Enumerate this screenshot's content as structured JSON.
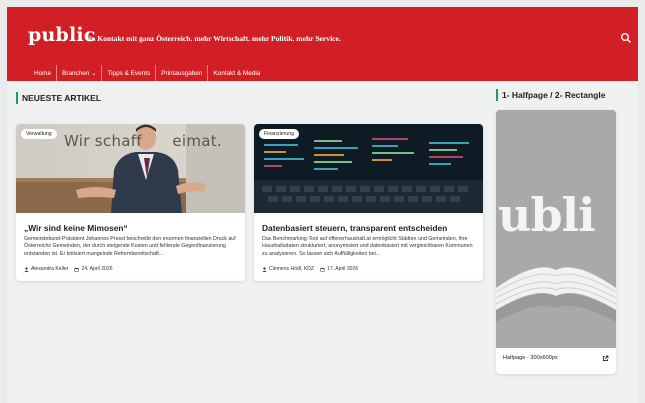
{
  "header": {
    "logo": "public",
    "tagline": "in Kontakt mit ganz Österreich. mehr Wirtschaft. mehr Politik. mehr Service."
  },
  "nav": {
    "items": [
      "Home",
      "Branchen",
      "Tipps & Events",
      "Printausgaben",
      "Kontakt & Media"
    ]
  },
  "sections": {
    "articles_heading": "NEUESTE ARTIKEL",
    "ad_heading": "1- Halfpage / 2- Rectangle"
  },
  "articles": [
    {
      "badge": "Verwaltung",
      "image_text": "Wir schaff      eimat.",
      "title": "„Wir sind keine Mimosen“",
      "text": "Gemeindebund-Präsident Johannes Pressl beschreibt den enormen finanziellen Druck auf Österreichs Gemeinden, der durch steigende Kosten und fehlende Gegenfinanzierung entstanden ist. Er kritisiert mangelnde Reformbereitschaft...",
      "author": "Alexandra Keller",
      "date": "24. April 2026"
    },
    {
      "badge": "Finanzierung",
      "title": "Datenbasiert steuern, transparent entscheiden",
      "text": "Das Benchmarking-Tool auf offenerhaushalt.at ermöglicht Städten und Gemeinden, ihre Haushaltsdaten strukturiert, anonymisiert und datenbasiert mit vergleichbaren Kommunen zu analysieren. So lassen sich Auffälligkeiten bei...",
      "author": "Clemens Hödl, KDZ",
      "date": "17. April 2026"
    }
  ],
  "ad": {
    "image_text": "ubli",
    "label": "Halfpage - 300x600px"
  },
  "colors": {
    "brand_red": "#d21f26",
    "accent_green": "#1f9c5a",
    "background": "#eef1f0"
  },
  "icons": {
    "search": "search-icon",
    "chevron": "chevron-down-icon",
    "author": "person-icon",
    "date": "calendar-icon",
    "external": "external-link-icon"
  }
}
